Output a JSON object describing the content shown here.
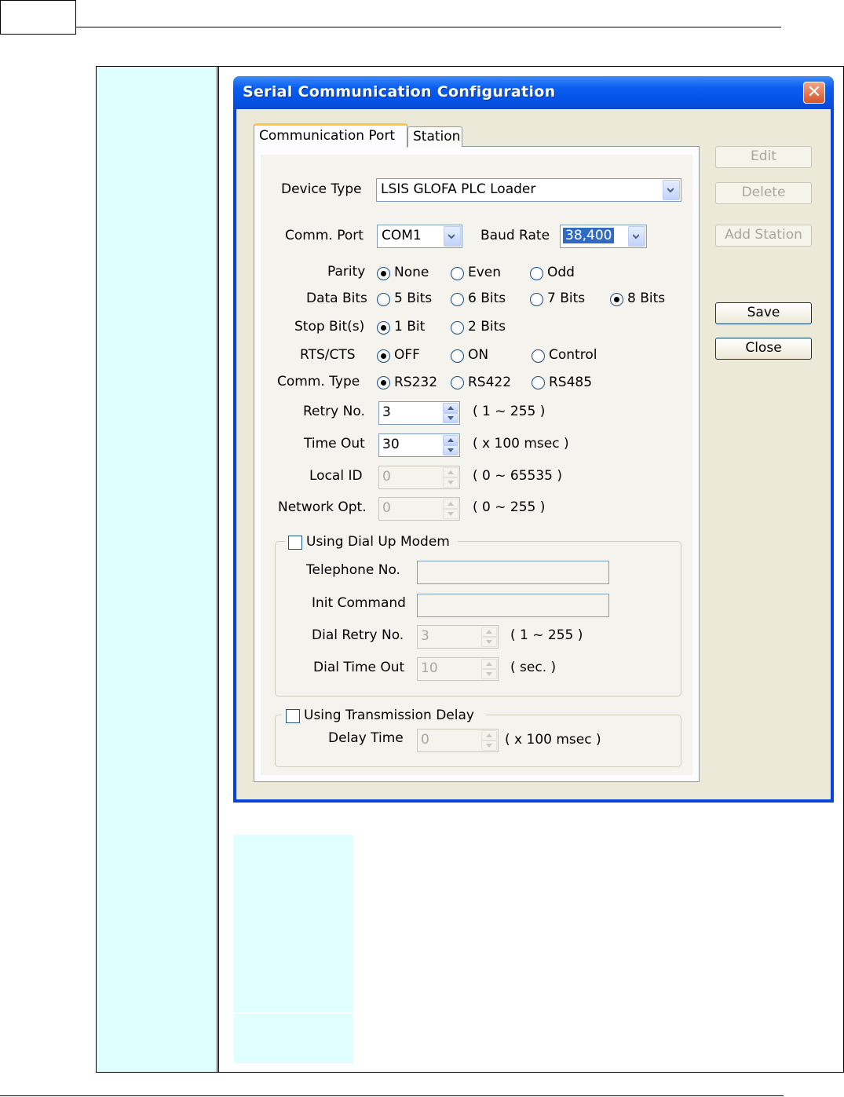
{
  "dialog": {
    "title": "Serial Communication Configuration",
    "close_glyph": "✕",
    "tabs": [
      {
        "label": "Communication Port",
        "active": true
      },
      {
        "label": "Station",
        "active": false
      }
    ],
    "side_buttons": {
      "edit": "Edit",
      "delete": "Delete",
      "add_station": "Add Station",
      "save": "Save",
      "close": "Close"
    },
    "device_type": {
      "label": "Device Type",
      "value": "LSIS GLOFA PLC Loader"
    },
    "comm_port": {
      "label": "Comm. Port",
      "value": "COM1"
    },
    "baud_rate": {
      "label": "Baud Rate",
      "value": "38,400"
    },
    "parity": {
      "label": "Parity",
      "options": [
        "None",
        "Even",
        "Odd"
      ],
      "selected": "None"
    },
    "data_bits": {
      "label": "Data Bits",
      "options": [
        "5 Bits",
        "6 Bits",
        "7 Bits",
        "8 Bits"
      ],
      "selected": "8 Bits"
    },
    "stop_bits": {
      "label": "Stop Bit(s)",
      "options": [
        "1 Bit",
        "2 Bits"
      ],
      "selected": "1 Bit"
    },
    "rts_cts": {
      "label": "RTS/CTS",
      "options": [
        "OFF",
        "ON",
        "Control"
      ],
      "selected": "OFF"
    },
    "comm_type": {
      "label": "Comm. Type",
      "options": [
        "RS232",
        "RS422",
        "RS485"
      ],
      "selected": "RS232"
    },
    "retry_no": {
      "label": "Retry No.",
      "value": "3",
      "range": "( 1 ~ 255 )"
    },
    "time_out": {
      "label": "Time Out",
      "value": "30",
      "range": "( x 100 msec )"
    },
    "local_id": {
      "label": "Local ID",
      "value": "0",
      "range": "( 0 ~ 65535 )"
    },
    "network_opt": {
      "label": "Network Opt.",
      "value": "0",
      "range": "( 0 ~ 255 )"
    },
    "dial_up": {
      "label": "Using Dial Up Modem",
      "checked": false,
      "telephone_label": "Telephone No.",
      "telephone_value": "",
      "init_label": "Init Command",
      "init_value": "",
      "dial_retry_label": "Dial Retry No.",
      "dial_retry_value": "3",
      "dial_retry_range": "( 1 ~ 255 )",
      "dial_timeout_label": "Dial Time Out",
      "dial_timeout_value": "10",
      "dial_timeout_range": "( sec. )"
    },
    "transmission_delay": {
      "label": "Using Transmission Delay",
      "checked": false,
      "delay_label": "Delay Time",
      "delay_value": "0",
      "delay_range": "( x 100 msec )"
    }
  },
  "colors": {
    "title_bar": "#0a5ef0",
    "dialog_face": "#ece9d8",
    "side_panel": "#dfffff",
    "active_tab_accent": "#ffc83c",
    "close_button": "#d6542a"
  }
}
